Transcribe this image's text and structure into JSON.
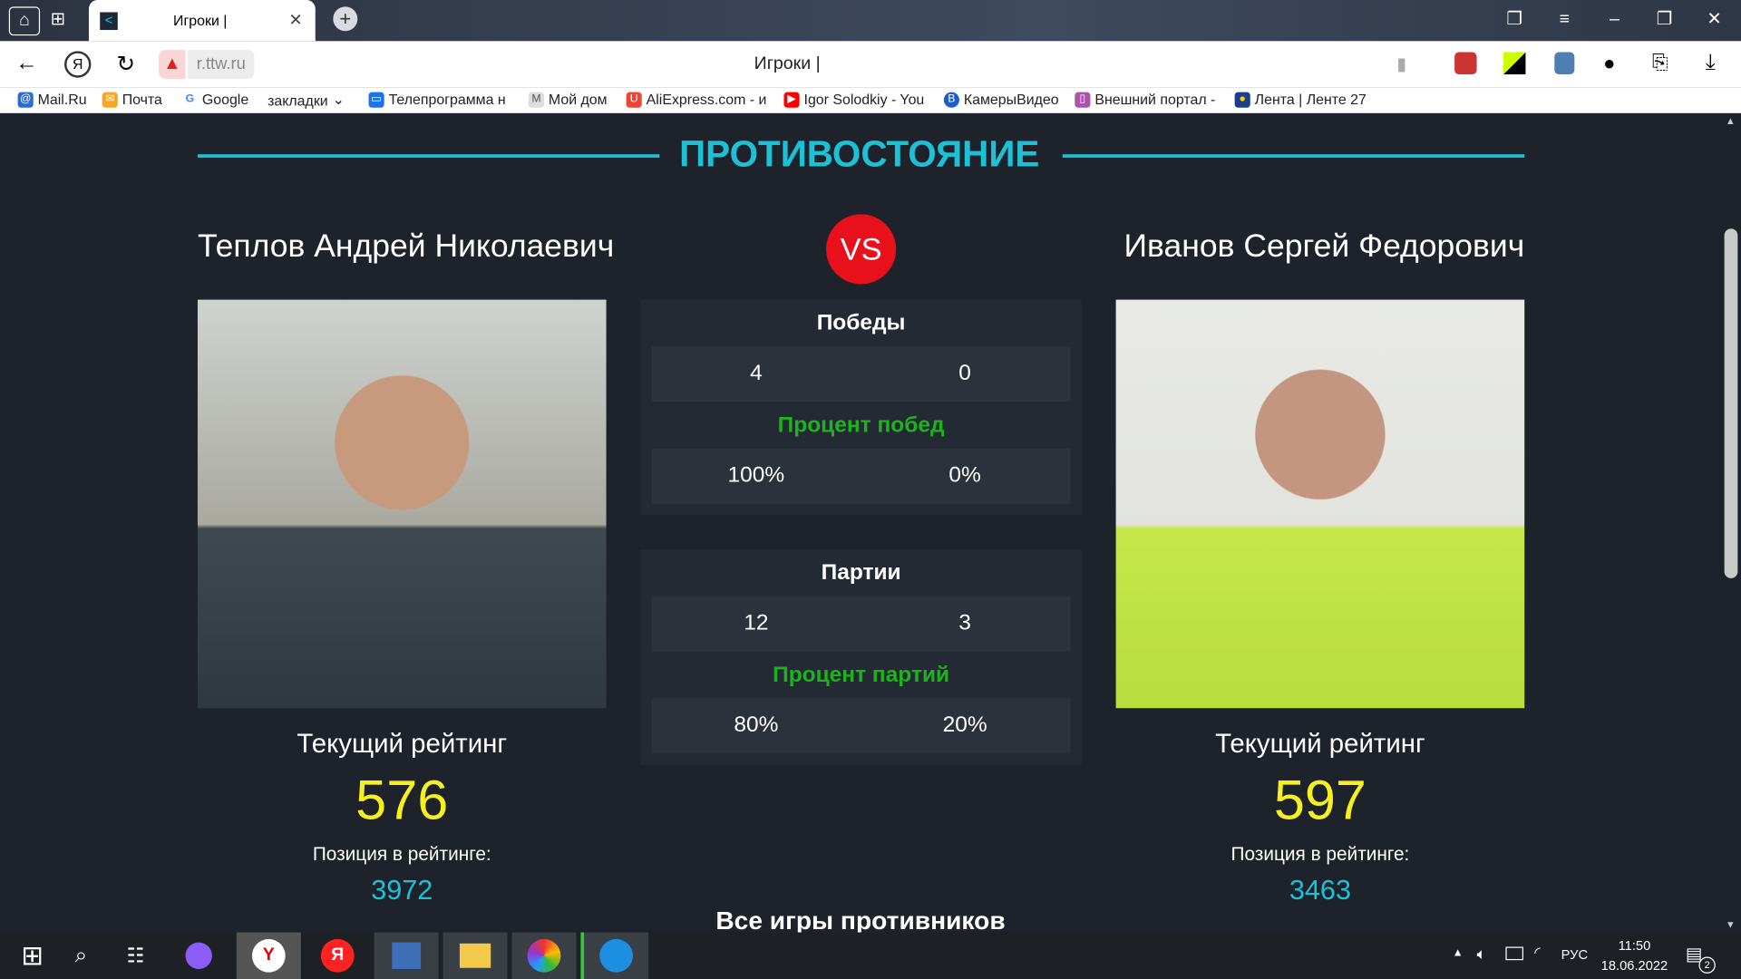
{
  "browser": {
    "tab_title": "Игроки |",
    "address": "r.ttw.ru",
    "page_title": "Игроки |",
    "bookmarks": [
      "Mail.Ru",
      "Почта",
      "Google",
      "закладки",
      "Телепрограмма н",
      "Мой дом",
      "AliExpress.com - и",
      "Igor Solodkiy - You",
      "КамерыВидео",
      "Внешний портал -",
      "Лента | Ленте 27"
    ]
  },
  "page": {
    "heading": "ПРОТИВОСТОЯНИЕ",
    "vs": "VS",
    "player1": {
      "name": "Теплов Андрей Николаевич",
      "rating_label": "Текущий рейтинг",
      "rating": "576",
      "position_label": "Позиция в рейтинге:",
      "position": "3972"
    },
    "player2": {
      "name": "Иванов Сергей Федорович",
      "rating_label": "Текущий рейтинг",
      "rating": "597",
      "position_label": "Позиция в рейтинге:",
      "position": "3463"
    },
    "wins": {
      "title": "Победы",
      "p1": "4",
      "p2": "0",
      "pct_title": "Процент побед",
      "p1_pct": "100%",
      "p2_pct": "0%"
    },
    "sets": {
      "title": "Партии",
      "p1": "12",
      "p2": "3",
      "pct_title": "Процент партий",
      "p1_pct": "80%",
      "p2_pct": "20%"
    },
    "all_games": "Все игры противников"
  },
  "taskbar": {
    "lang": "РУС",
    "time": "11:50",
    "date": "18.06.2022",
    "notifications": "2"
  },
  "colors": {
    "accent": "#1ec0d6",
    "rating": "#f5f01e",
    "green": "#1fb21f",
    "vs": "#e8101a"
  }
}
